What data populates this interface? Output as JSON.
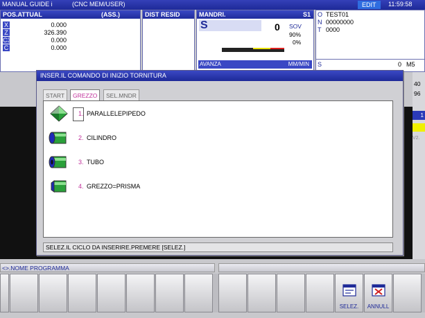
{
  "topbar": {
    "guide": "MANUAL GUIDE i",
    "mode": "(CNC MEM/USER)",
    "edit": "EDIT",
    "clock": "11:59:58"
  },
  "position": {
    "title": "POS.ATTUAL",
    "subtitle": "(ASS.)",
    "axes": [
      {
        "name": "X",
        "value": "0.000"
      },
      {
        "name": "Z",
        "value": "326.390"
      },
      {
        "name": "C3",
        "value": "0.000"
      },
      {
        "name": "C",
        "value": "0.000"
      }
    ]
  },
  "residual": {
    "title": "DIST RESID"
  },
  "spindle": {
    "title": "MANDRI.",
    "channel": "S1",
    "letter": "S",
    "value": "0",
    "sov_label": "SOV",
    "sov_value": "90%",
    "load": "0%",
    "load_fraction": 0.0,
    "sub_title": "AVANZA",
    "sub_right": "MM/MIN"
  },
  "program": {
    "o_label": "O",
    "o_value": "TEST01",
    "n_label": "N",
    "n_value": "00000000",
    "t_label": "T",
    "t_value": "0000",
    "s_label": "S",
    "s_value": "0",
    "m_value": "M5",
    "right_40": "40",
    "right_96": "96",
    "right_1": "1",
    "right_v2": "V2."
  },
  "dialog": {
    "title": "INSER.IL COMANDO DI INIZIO TORNITURA",
    "tabs": [
      "START",
      "GREZZO",
      "SEL.MNDR"
    ],
    "active_tab": 1,
    "items": [
      {
        "num": "1.",
        "label": "PARALLELEPIPEDO",
        "icon": "parallelepiped-icon"
      },
      {
        "num": "2.",
        "label": "CILINDRO",
        "icon": "cylinder-icon"
      },
      {
        "num": "3.",
        "label": "TUBO",
        "icon": "tube-icon"
      },
      {
        "num": "4.",
        "label": "GREZZO=PRISMA",
        "icon": "prism-icon"
      }
    ],
    "message": "SELEZ.IL CICLO DA INSERIRE.PREMERE [SELEZ.]"
  },
  "bottom": {
    "prog_name": "<>.NOME PROGRAMMA",
    "softkeys": [
      {
        "label": ""
      },
      {
        "label": ""
      },
      {
        "label": ""
      },
      {
        "label": ""
      },
      {
        "label": ""
      },
      {
        "label": ""
      },
      {
        "label": ""
      },
      {
        "label": ""
      },
      {
        "label": "SELEZ.",
        "icon": "select-icon"
      },
      {
        "label": "ANNULL",
        "icon": "cancel-icon"
      },
      {
        "label": ""
      }
    ]
  },
  "colors": {
    "accent": "#1e2a98",
    "magenta": "#c0309a",
    "yellow": "#f0f000"
  }
}
